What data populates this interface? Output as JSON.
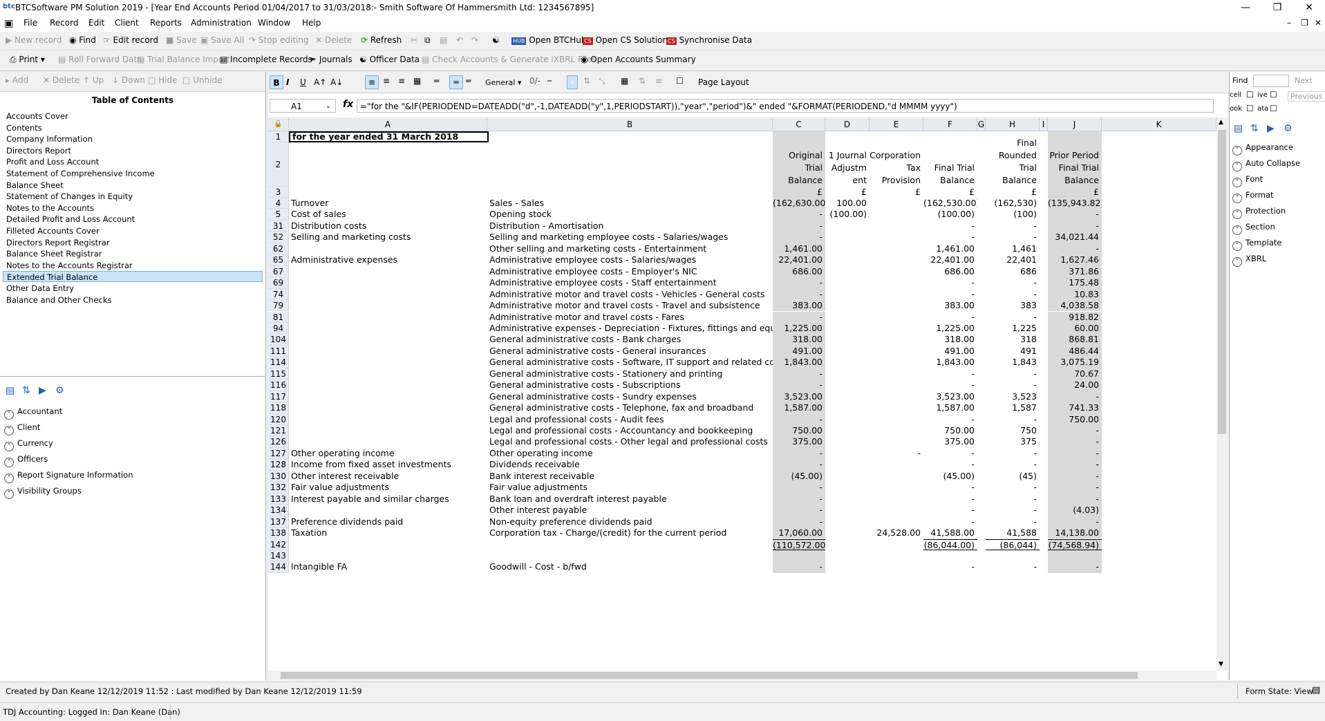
{
  "window": {
    "title": "BTCSoftware PM Solution 2019 - [Year End Accounts Period 01/04/2017 to 31/03/2018:- Smith Software Of Hammersmith Ltd: 1234567895]",
    "logo_text": "btc"
  },
  "menu": [
    "File",
    "Record",
    "Edit",
    "Client",
    "Reports",
    "Administration",
    "Window",
    "Help"
  ],
  "toolbar1": {
    "new_record": "New record",
    "find": "Find",
    "edit_record": "Edit record",
    "save": "Save",
    "save_all": "Save All",
    "stop_editing": "Stop editing",
    "delete": "Delete",
    "refresh": "Refresh",
    "open_btchub": "Open BTCHub",
    "open_cs": "Open CS Solution",
    "sync": "Synchronise Data"
  },
  "toolbar2": {
    "print": "Print",
    "roll_forward": "Roll Forward Data",
    "tb_import": "Trial Balance Import",
    "incomplete": "Incomplete Records",
    "journals": "Journals",
    "officer": "Officer Data",
    "check_accounts": "Check Accounts & Generate iXBRL Files",
    "open_summary": "Open Accounts Summary"
  },
  "left_toolbar": {
    "add": "Add",
    "delete": "Delete",
    "up": "Up",
    "down": "Down",
    "hide": "Hide",
    "unhide": "Unhide"
  },
  "toc": {
    "title": "Table of Contents",
    "items": [
      "Accounts Cover",
      "Contents",
      "Company Information",
      "Directors Report",
      "Profit and Loss Account",
      "Statement of Comprehensive Income",
      "Balance Sheet",
      "Statement of Changes in Equity",
      "Notes to the Accounts",
      "Detailed Profit and Loss Account",
      "Filleted Accounts Cover",
      "Directors Report Registrar",
      "Balance Sheet Registrar",
      "Notes to the Accounts Registrar",
      "Extended Trial Balance",
      "Other Data Entry",
      "Balance and Other Checks"
    ],
    "selected": "Extended Trial Balance"
  },
  "properties": [
    "Accountant",
    "Client",
    "Currency",
    "Officers",
    "Report Signature Information",
    "Visibility Groups"
  ],
  "format_bar": {
    "number_format": "General",
    "page_layout": "Page Layout"
  },
  "formula_bar": {
    "cell_ref": "A1",
    "formula": "=\"for the \"&IF(PERIODEND=DATEADD(\"d\",-1,DATEADD(\"y\",1,PERIODSTART)),\"year\",\"period\")&\" ended \"&FORMAT(PERIODEND,\"d MMMM yyyy\")"
  },
  "columns": [
    "A",
    "B",
    "C",
    "D",
    "E",
    "F",
    "G",
    "H",
    "I",
    "J",
    "K"
  ],
  "headers": {
    "c": [
      "Original Trial",
      "Balance"
    ],
    "d": [
      "1 Journal",
      "Adjustm",
      "ent"
    ],
    "e": [
      "Corporation",
      "Tax Provision"
    ],
    "f": [
      "Final Trial",
      "Balance"
    ],
    "h": [
      "Final",
      "Rounded Trial",
      "Balance"
    ],
    "j": [
      "Prior Period",
      "Final Trial",
      "Balance"
    ]
  },
  "a1_text": "for the year ended 31 March 2018",
  "currency_symbol": "£",
  "rows": [
    {
      "n": "4",
      "a": "Turnover",
      "b": "Sales - Sales",
      "c": "(162,630.00)",
      "d": "100.00",
      "e": "",
      "f": "(162,530.00)",
      "h": "(162,530)",
      "j": "(135,943.82)"
    },
    {
      "n": "5",
      "a": "Cost of sales",
      "b": "Opening stock",
      "c": "-",
      "d": "(100.00)",
      "e": "",
      "f": "(100.00)",
      "h": "(100)",
      "j": "-"
    },
    {
      "n": "31",
      "a": "Distribution costs",
      "b": "Distribution - Amortisation",
      "c": "-",
      "d": "",
      "e": "",
      "f": "-",
      "h": "-",
      "j": "-"
    },
    {
      "n": "52",
      "a": "Selling and marketing costs",
      "b": "Selling and marketing employee costs - Salaries/wages",
      "c": "-",
      "d": "",
      "e": "",
      "f": "-",
      "h": "-",
      "j": "34,021.44"
    },
    {
      "n": "62",
      "a": "",
      "b": "Other selling and marketing costs - Entertainment",
      "c": "1,461.00",
      "d": "",
      "e": "",
      "f": "1,461.00",
      "h": "1,461",
      "j": "-"
    },
    {
      "n": "65",
      "a": "Administrative expenses",
      "b": "Administrative employee costs - Salaries/wages",
      "c": "22,401.00",
      "d": "",
      "e": "",
      "f": "22,401.00",
      "h": "22,401",
      "j": "1,627.46"
    },
    {
      "n": "67",
      "a": "",
      "b": "Administrative employee costs - Employer's NIC",
      "c": "686.00",
      "d": "",
      "e": "",
      "f": "686.00",
      "h": "686",
      "j": "371.86"
    },
    {
      "n": "69",
      "a": "",
      "b": "Administrative employee costs - Staff entertainment",
      "c": "-",
      "d": "",
      "e": "",
      "f": "-",
      "h": "-",
      "j": "175.48"
    },
    {
      "n": "74",
      "a": "",
      "b": "Administrative motor and travel costs - Vehicles - General costs",
      "c": "-",
      "d": "",
      "e": "",
      "f": "-",
      "h": "-",
      "j": "10.83"
    },
    {
      "n": "79",
      "a": "",
      "b": "Administrative motor and travel costs - Travel and subsistence",
      "c": "383.00",
      "d": "",
      "e": "",
      "f": "383.00",
      "h": "383",
      "j": "4,038.58"
    },
    {
      "n": "81",
      "a": "",
      "b": "Administrative motor and travel costs - Fares",
      "c": "-",
      "d": "",
      "e": "",
      "f": "-",
      "h": "-",
      "j": "918.82"
    },
    {
      "n": "94",
      "a": "",
      "b": "Administrative expenses - Depreciation - Fixtures, fittings and equipment",
      "c": "1,225.00",
      "d": "",
      "e": "",
      "f": "1,225.00",
      "h": "1,225",
      "j": "60.00"
    },
    {
      "n": "104",
      "a": "",
      "b": "General administrative costs - Bank charges",
      "c": "318.00",
      "d": "",
      "e": "",
      "f": "318.00",
      "h": "318",
      "j": "868.81"
    },
    {
      "n": "111",
      "a": "",
      "b": "General administrative costs - General insurances",
      "c": "491.00",
      "d": "",
      "e": "",
      "f": "491.00",
      "h": "491",
      "j": "486.44"
    },
    {
      "n": "114",
      "a": "",
      "b": "General administrative costs - Software, IT support and related costs",
      "c": "1,843.00",
      "d": "",
      "e": "",
      "f": "1,843.00",
      "h": "1,843",
      "j": "3,075.19"
    },
    {
      "n": "115",
      "a": "",
      "b": "General administrative costs - Stationery and printing",
      "c": "-",
      "d": "",
      "e": "",
      "f": "-",
      "h": "-",
      "j": "70.67"
    },
    {
      "n": "116",
      "a": "",
      "b": "General administrative costs - Subscriptions",
      "c": "-",
      "d": "",
      "e": "",
      "f": "-",
      "h": "-",
      "j": "24.00"
    },
    {
      "n": "117",
      "a": "",
      "b": "General administrative costs - Sundry expenses",
      "c": "3,523.00",
      "d": "",
      "e": "",
      "f": "3,523.00",
      "h": "3,523",
      "j": "-"
    },
    {
      "n": "118",
      "a": "",
      "b": "General administrative costs - Telephone, fax and broadband",
      "c": "1,587.00",
      "d": "",
      "e": "",
      "f": "1,587.00",
      "h": "1,587",
      "j": "741.33"
    },
    {
      "n": "120",
      "a": "",
      "b": "Legal and professional costs - Audit fees",
      "c": "-",
      "d": "",
      "e": "",
      "f": "-",
      "h": "-",
      "j": "750.00"
    },
    {
      "n": "121",
      "a": "",
      "b": "Legal and professional costs - Accountancy and bookkeeping",
      "c": "750.00",
      "d": "",
      "e": "",
      "f": "750.00",
      "h": "750",
      "j": "-"
    },
    {
      "n": "126",
      "a": "",
      "b": "Legal and professional costs - Other legal and professional costs",
      "c": "375.00",
      "d": "",
      "e": "",
      "f": "375.00",
      "h": "375",
      "j": "-"
    },
    {
      "n": "127",
      "a": "Other operating income",
      "b": "Other operating income",
      "c": "-",
      "d": "",
      "e": "-",
      "f": "-",
      "h": "-",
      "j": "-"
    },
    {
      "n": "128",
      "a": "Income from fixed asset investments",
      "b": "Dividends receivable",
      "c": "-",
      "d": "",
      "e": "",
      "f": "-",
      "h": "-",
      "j": "-"
    },
    {
      "n": "130",
      "a": "Other interest receivable",
      "b": "Bank interest receivable",
      "c": "(45.00)",
      "d": "",
      "e": "",
      "f": "(45.00)",
      "h": "(45)",
      "j": "-"
    },
    {
      "n": "132",
      "a": "Fair value adjustments",
      "b": "Fair value adjustments",
      "c": "-",
      "d": "",
      "e": "",
      "f": "-",
      "h": "-",
      "j": "-"
    },
    {
      "n": "133",
      "a": "Interest payable and similar charges",
      "b": "Bank loan and overdraft interest payable",
      "c": "-",
      "d": "",
      "e": "",
      "f": "-",
      "h": "-",
      "j": "-"
    },
    {
      "n": "134",
      "a": "",
      "b": "Other interest payable",
      "c": "-",
      "d": "",
      "e": "",
      "f": "-",
      "h": "-",
      "j": "(4.03)"
    },
    {
      "n": "137",
      "a": "Preference dividends paid",
      "b": "Non-equity preference dividends paid",
      "c": "-",
      "d": "",
      "e": "",
      "f": "-",
      "h": "-",
      "j": "-"
    },
    {
      "n": "138",
      "a": "Taxation",
      "b": "Corporation tax - Charge/(credit) for the current period",
      "c": "17,060.00",
      "d": "",
      "e": "24,528.00",
      "f": "41,588.00",
      "h": "41,588",
      "j": "14,138.00"
    },
    {
      "n": "142",
      "a": "",
      "b": "",
      "c": "(110,572.00)",
      "d": "",
      "e": "",
      "f": "(86,044.00)",
      "h": "(86,044)",
      "j": "(74,568.94)"
    },
    {
      "n": "143",
      "a": "",
      "b": "",
      "c": "",
      "d": "",
      "e": "",
      "f": "",
      "h": "",
      "j": ""
    },
    {
      "n": "144",
      "a": "Intangible FA",
      "b": "Goodwill - Cost - b/fwd",
      "c": "-",
      "d": "",
      "e": "",
      "f": "-",
      "h": "-",
      "j": "-"
    }
  ],
  "right_pane": {
    "find_label": "Find",
    "next": "Next",
    "previous": "Previous",
    "opt1": "cell",
    "opt2": "ive",
    "opt3": "ook",
    "opt4": "ata",
    "props": [
      "Appearance",
      "Auto Collapse",
      "Font",
      "Format",
      "Protection",
      "Section",
      "Template",
      "XBRL"
    ]
  },
  "status": {
    "created": "Created by Dan Keane 12/12/2019 11:52 : Last modified by Dan Keane 12/12/2019 11:59",
    "form_state": "Form State: View",
    "logged_in": "TDJ Accounting: Logged In: Dan Keane (Dan)"
  },
  "colors": {
    "selection": "#cce4f7",
    "shade": "#d9d9d9",
    "header": "#e6ebf2"
  }
}
